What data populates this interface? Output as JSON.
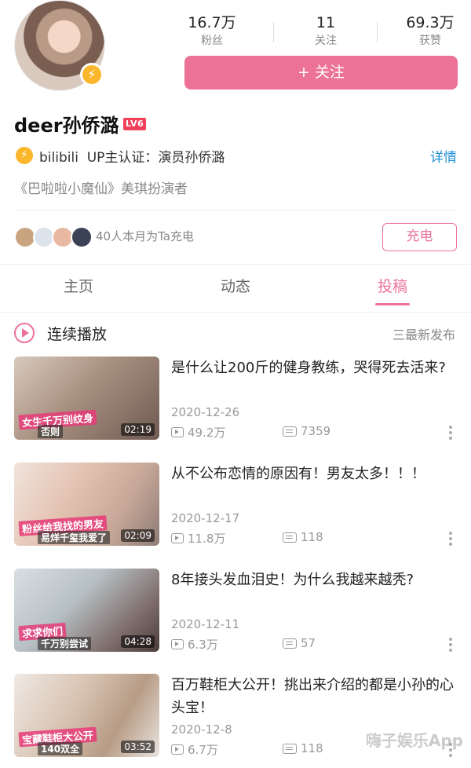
{
  "header": {
    "stats": [
      {
        "value": "16.7万",
        "label": "粉丝"
      },
      {
        "value": "11",
        "label": "关注"
      },
      {
        "value": "69.3万",
        "label": "获赞"
      }
    ],
    "follow_label": "+ 关注"
  },
  "profile": {
    "name": "deer孙侨潞",
    "level": "LV6",
    "cert_brand": "bilibili",
    "cert_text": "UP主认证：演员孙侨潞",
    "details_label": "详情",
    "bio": "《巴啦啦小魔仙》美琪扮演者"
  },
  "charge": {
    "text": "40人本月为Ta充电",
    "button_label": "充电"
  },
  "tabs": [
    {
      "label": "主页"
    },
    {
      "label": "动态"
    },
    {
      "label": "投稿"
    }
  ],
  "playlist": {
    "continuous_label": "连续播放",
    "sort_label": "三最新发布"
  },
  "videos": [
    {
      "title": "是什么让200斤的健身教练，哭得死去活来?",
      "date": "2020-12-26",
      "views": "49.2万",
      "comments": "7359",
      "duration": "02:19",
      "caption": "女生千万别纹身",
      "caption2": "否则"
    },
    {
      "title": "从不公布恋情的原因有！男友太多！！！",
      "date": "2020-12-17",
      "views": "11.8万",
      "comments": "118",
      "duration": "02:09",
      "caption": "粉丝给我找的男友",
      "caption2": "易烊千玺我爱了"
    },
    {
      "title": "8年接头发血泪史！为什么我越来越秃?",
      "date": "2020-12-11",
      "views": "6.3万",
      "comments": "57",
      "duration": "04:28",
      "caption": "求求你们",
      "caption2": "千万别尝试"
    },
    {
      "title": "百万鞋柜大公开！挑出来介绍的都是小孙的心头宝！",
      "date": "2020-12-8",
      "views": "6.7万",
      "comments": "118",
      "duration": "03:52",
      "caption": "宝藏鞋柜大公开",
      "caption2": "140双全"
    }
  ],
  "watermark": "嗨子娱乐App",
  "colors": {
    "accent": "#ec7298",
    "link": "#1e8fd5",
    "badge": "#fbb72c"
  }
}
